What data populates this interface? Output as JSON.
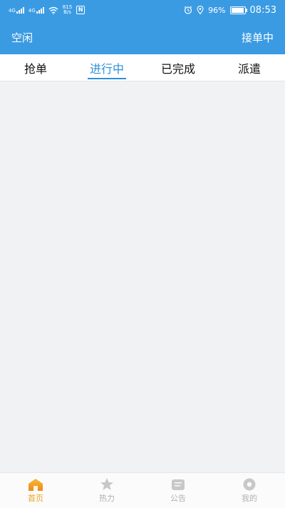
{
  "status_bar": {
    "carrier1": "4G",
    "carrier2": "4G",
    "net_speed_value": "815",
    "net_speed_unit": "B/s",
    "nfc": "N",
    "battery_percent": "96%",
    "battery_level": 0.96,
    "time": "08:53"
  },
  "app_bar": {
    "left_label": "空闲",
    "right_label": "接单中"
  },
  "tabs": [
    {
      "label": "抢单",
      "active": false
    },
    {
      "label": "进行中",
      "active": true
    },
    {
      "label": "已完成",
      "active": false
    },
    {
      "label": "派遣",
      "active": false
    }
  ],
  "bottom_nav": [
    {
      "label": "首页",
      "icon": "home-icon",
      "active": true
    },
    {
      "label": "热力",
      "icon": "heat-icon",
      "active": false
    },
    {
      "label": "公告",
      "icon": "notice-icon",
      "active": false
    },
    {
      "label": "我的",
      "icon": "profile-icon",
      "active": false
    }
  ],
  "colors": {
    "primary": "#3a9be3",
    "tab_active": "#2f8fd9",
    "nav_active": "#f0a21f",
    "nav_inactive": "#b0b0b0"
  }
}
